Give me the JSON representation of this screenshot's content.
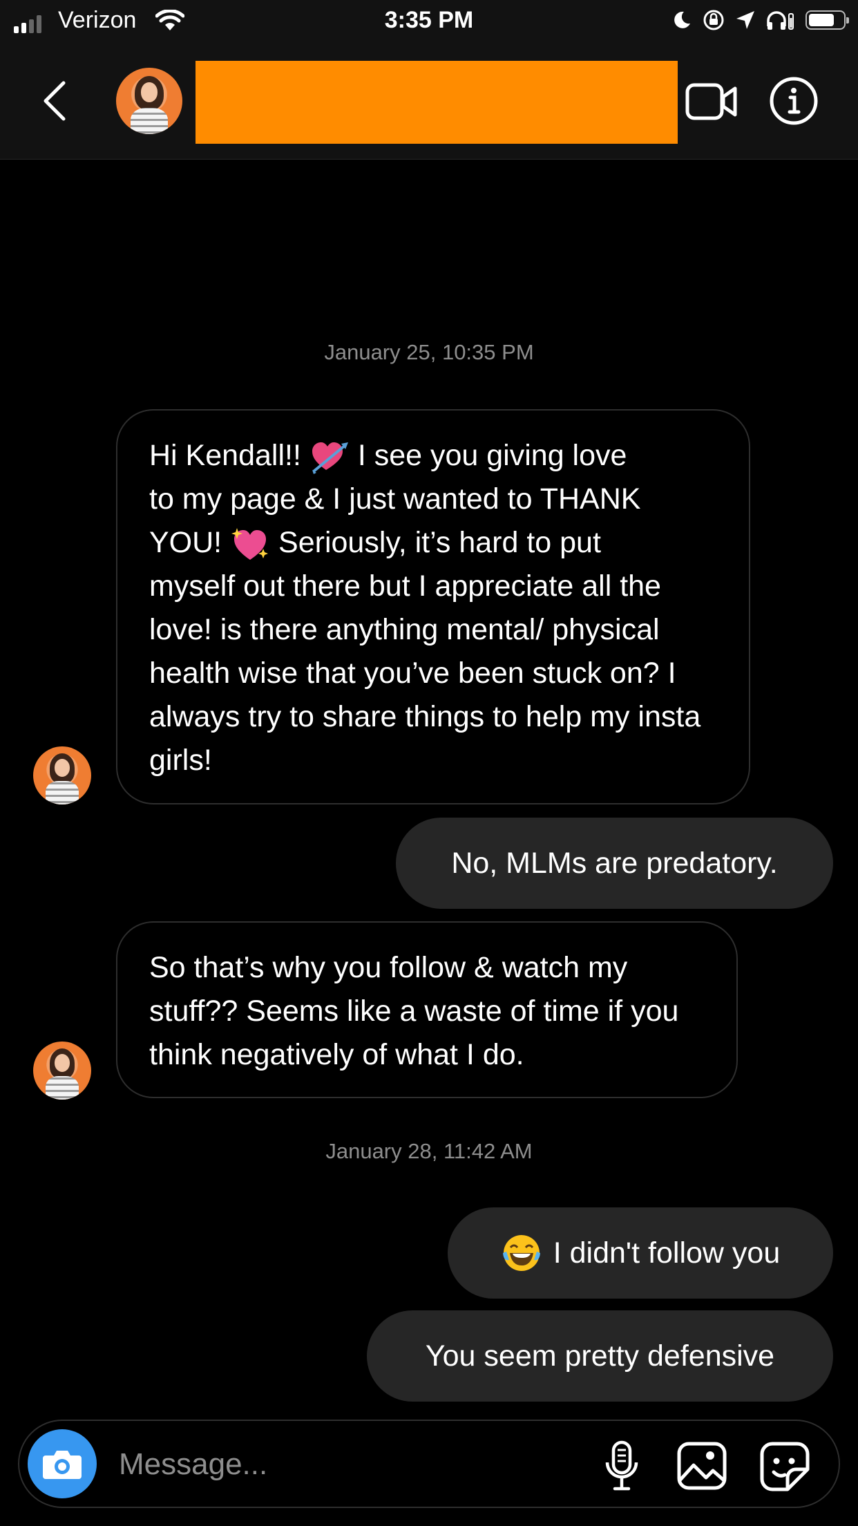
{
  "status_bar": {
    "carrier": "Verizon",
    "time": "3:35 PM",
    "icons": [
      "signal-icon",
      "wifi-icon",
      "moon-icon",
      "orientation-lock-icon",
      "location-icon",
      "headphones-icon",
      "battery-icon"
    ]
  },
  "header": {
    "contact_name_redacted_color": "#ff8c00",
    "icons": [
      "back-arrow-icon",
      "video-call-icon",
      "info-icon"
    ]
  },
  "conversation": {
    "timestamp_1": "January 25, 10:35 PM",
    "msg_1": {
      "line_1_before": "Hi Kendall!!",
      "line_1_after": "I see you giving love",
      "line_2": "to my page & I just wanted to THANK",
      "line_3_before": "YOU!",
      "line_3_after": "Seriously, it’s hard to put",
      "rest": "myself out there but I appreciate all the love! is there anything mental/ physical health wise that you’ve been stuck on? I always try to share things to help my insta girls!"
    },
    "msg_2": "No, MLMs are predatory.",
    "msg_3": "So that’s why you follow & watch my stuff?? Seems like a waste of time if you think negatively of what I do.",
    "timestamp_2": "January 28, 11:42 AM",
    "msg_4": "I didn't follow you",
    "msg_5": "You seem pretty defensive"
  },
  "composer": {
    "placeholder": "Message...",
    "icons": [
      "camera-icon",
      "microphone-icon",
      "gallery-icon",
      "sticker-icon"
    ],
    "accent_color": "#3797f0"
  },
  "colors": {
    "background": "#000000",
    "outgoing_bubble": "#262626",
    "timestamp": "#8e8e8e"
  }
}
